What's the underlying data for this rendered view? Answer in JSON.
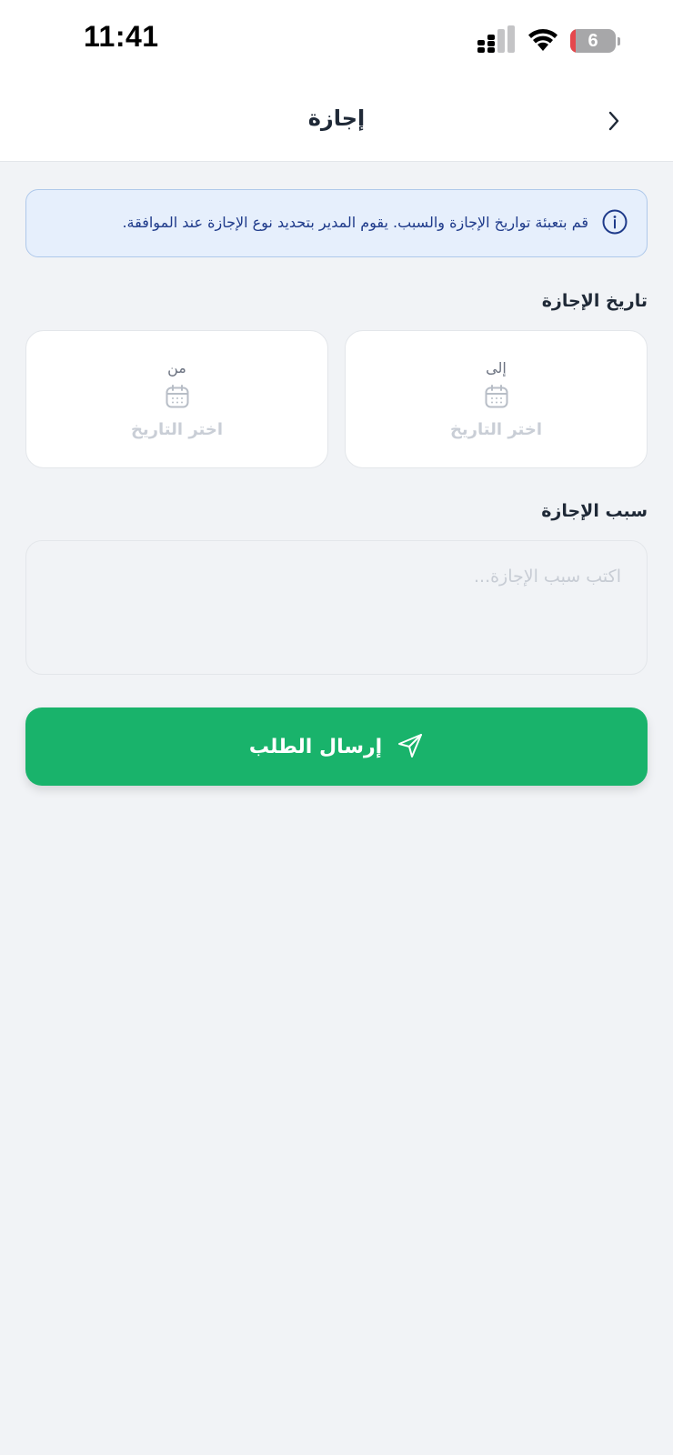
{
  "status_bar": {
    "time": "11:41",
    "battery_level": "6",
    "icons": [
      "cellular-signal-icon",
      "wifi-icon",
      "battery-icon"
    ]
  },
  "header": {
    "title": "إجازة",
    "back_icon": "chevron-right-icon"
  },
  "info_banner": {
    "icon": "info-icon",
    "text": "قم بتعبئة تواريخ الإجازة والسبب. يقوم المدير بتحديد نوع الإجازة عند الموافقة."
  },
  "dates_section": {
    "label": "تاريخ الإجازة",
    "from": {
      "label": "من",
      "placeholder": "اختر التاريخ",
      "icon": "calendar-icon"
    },
    "to": {
      "label": "إلى",
      "placeholder": "اختر التاريخ",
      "icon": "calendar-icon"
    }
  },
  "reason_section": {
    "label": "سبب الإجازة",
    "placeholder": "اكتب سبب الإجازة...",
    "value": ""
  },
  "submit": {
    "label": "إرسال الطلب",
    "icon": "send-icon"
  },
  "colors": {
    "primary": "#19b36b",
    "info_bg": "#e6effc",
    "info_border": "#aec8ea",
    "info_text": "#1e3a8a",
    "background": "#f1f3f6"
  }
}
